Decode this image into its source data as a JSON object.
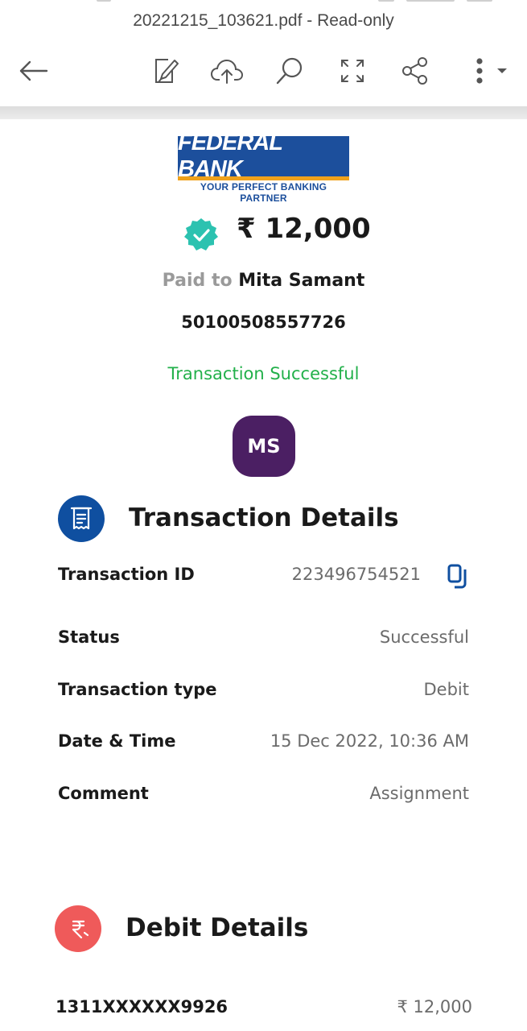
{
  "toolbar": {
    "document_title": "20221215_103621.pdf - Read-only",
    "icons": [
      "back-arrow-icon",
      "edit-icon",
      "cloud-upload-icon",
      "search-icon",
      "fullscreen-icon",
      "share-icon",
      "more-icon"
    ]
  },
  "receipt": {
    "bank_logo_name": "FEDERAL BANK",
    "bank_logo_tagline": "YOUR PERFECT BANKING PARTNER",
    "amount": "₹ 12,000",
    "paid_to_label": "Paid to",
    "payee_name": "Mita Samant",
    "payee_account": "50100508557726",
    "status_text": "Transaction Successful",
    "avatar_initials": "MS"
  },
  "transaction_details": {
    "title": "Transaction Details",
    "rows": [
      {
        "label": "Transaction ID",
        "value": "223496754521"
      },
      {
        "label": "Status",
        "value": "Successful"
      },
      {
        "label": "Transaction type",
        "value": "Debit"
      },
      {
        "label": "Date & Time",
        "value": "15 Dec 2022, 10:36 AM"
      },
      {
        "label": "Comment",
        "value": "Assignment"
      }
    ]
  },
  "debit_details": {
    "title": "Debit Details",
    "account": "1311XXXXXX9926",
    "amount": "₹ 12,000"
  },
  "colors": {
    "brand_blue": "#1c4f9c",
    "brand_orange": "#f0a21b",
    "success_green": "#22b04a",
    "badge_teal": "#2cc2b0",
    "avatar_purple": "#4b1f63",
    "section_icon_blue": "#0f4fa0",
    "debit_icon_red": "#ef5a5a"
  }
}
